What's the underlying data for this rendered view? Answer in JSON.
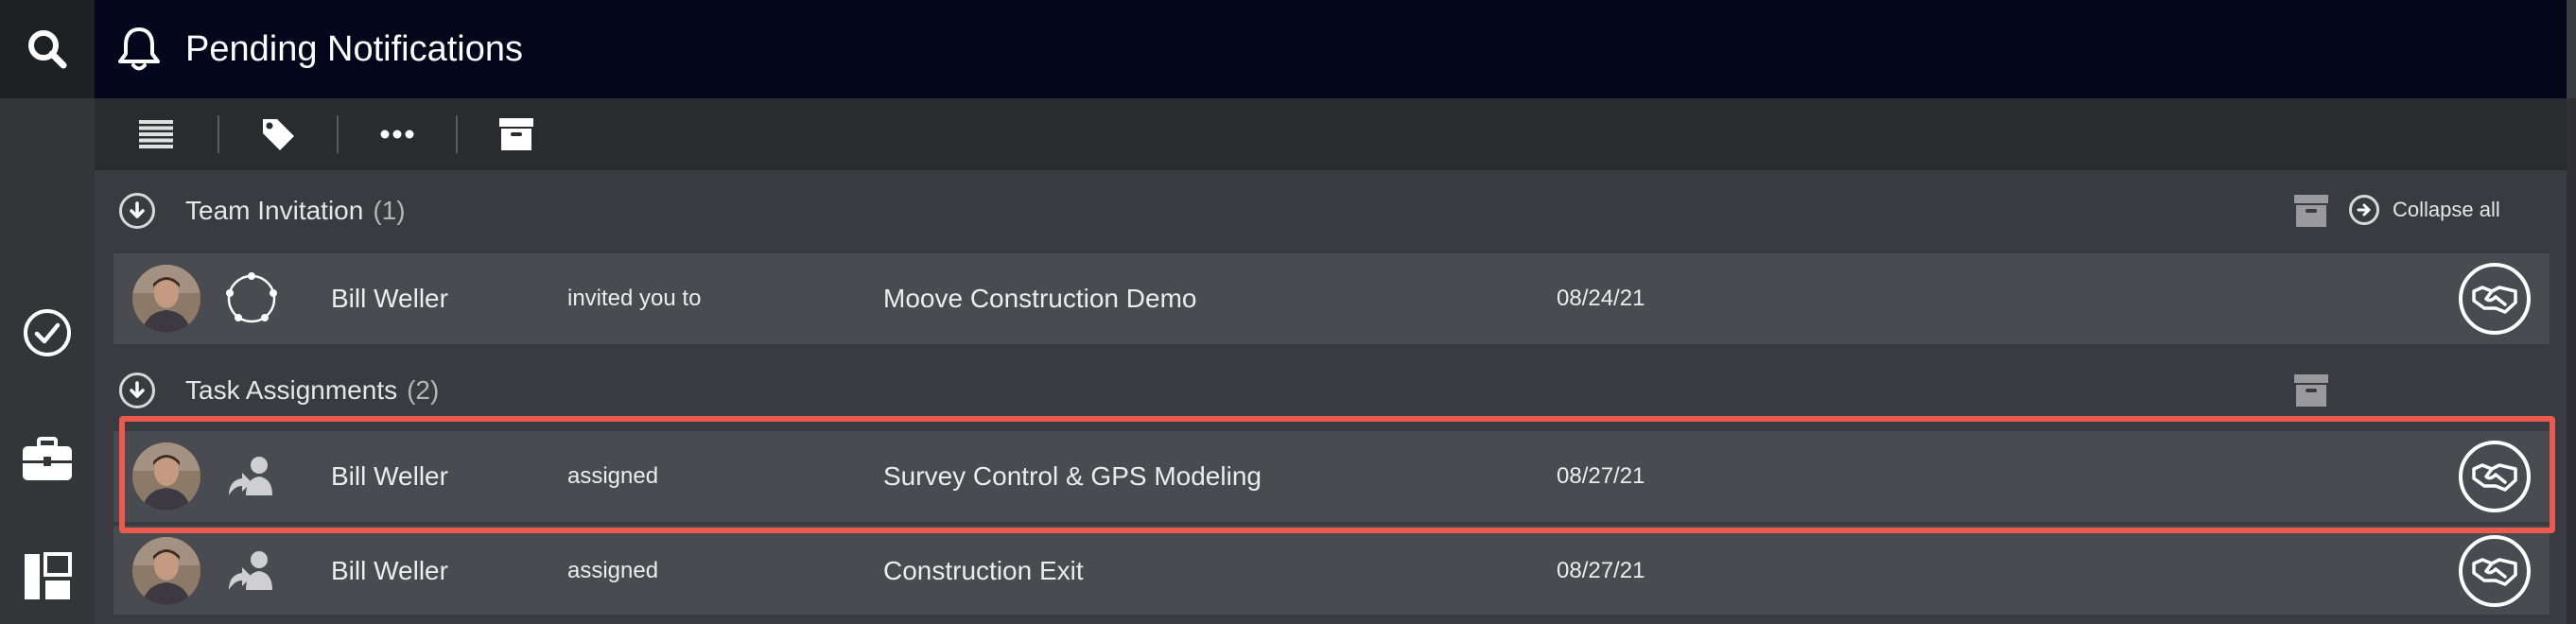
{
  "header": {
    "title": "Pending Notifications",
    "icon": "bell-icon"
  },
  "rail": {
    "items": [
      {
        "name": "search",
        "icon": "search-icon"
      },
      {
        "name": "tasks",
        "icon": "check-circle-icon"
      },
      {
        "name": "projects",
        "icon": "briefcase-icon"
      },
      {
        "name": "board",
        "icon": "layout-icon"
      }
    ]
  },
  "toolbar": {
    "items": [
      {
        "name": "list",
        "icon": "list-icon"
      },
      {
        "name": "tag",
        "icon": "tag-icon"
      },
      {
        "name": "more",
        "icon": "more-icon"
      },
      {
        "name": "archive",
        "icon": "archive-icon"
      }
    ]
  },
  "collapse_all_label": "Collapse all",
  "sections": [
    {
      "title": "Team Invitation",
      "count": "(1)",
      "rows": [
        {
          "who": "Bill Weller",
          "verb": "invited you to",
          "subject": "Moove Construction Demo",
          "date": "08/24/21",
          "type_icon": "team-circle-icon"
        }
      ]
    },
    {
      "title": "Task Assignments",
      "count": "(2)",
      "rows": [
        {
          "who": "Bill Weller",
          "verb": "assigned",
          "subject": "Survey Control & GPS Modeling",
          "date": "08/27/21",
          "type_icon": "assign-user-icon",
          "highlighted": true
        },
        {
          "who": "Bill Weller",
          "verb": "assigned",
          "subject": "Construction Exit",
          "date": "08/27/21",
          "type_icon": "assign-user-icon"
        }
      ]
    }
  ],
  "colors": {
    "header_bg": "#04061b",
    "row_bg": "#4a4b50",
    "highlight": "#ea5a4f"
  }
}
